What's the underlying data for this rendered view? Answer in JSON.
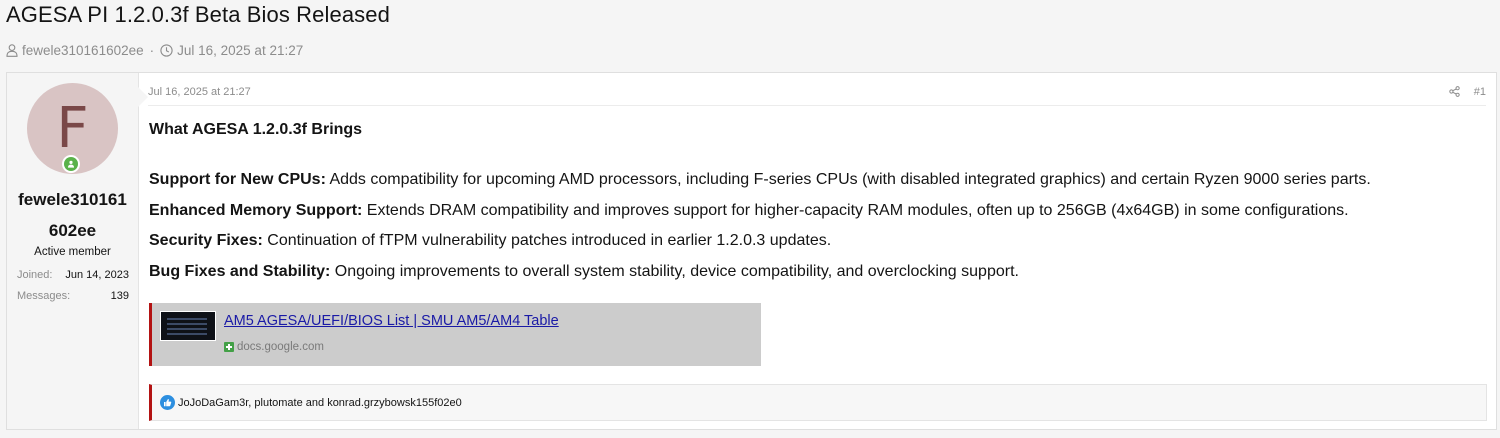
{
  "thread": {
    "title": "AGESA PI 1.2.0.3f Beta Bios Released",
    "author": "fewele310161602ee",
    "date": "Jul 16, 2025 at 21:27",
    "separator": "·"
  },
  "user": {
    "avatar_letter": "F",
    "name_line1": "fewele310161",
    "name_line2": "602ee",
    "title": "Active member",
    "joined_label": "Joined:",
    "joined_value": "Jun 14, 2023",
    "messages_label": "Messages:",
    "messages_value": "139"
  },
  "post": {
    "date": "Jul 16, 2025 at 21:27",
    "number": "#1",
    "heading": "What AGESA 1.2.0.3f Brings",
    "points": [
      {
        "label": "Support for New CPUs:",
        "text": " Adds compatibility for upcoming AMD processors, including F-series CPUs (with disabled integrated graphics) and certain Ryzen 9000 series parts."
      },
      {
        "label": "Enhanced Memory Support:",
        "text": " Extends DRAM compatibility and improves support for higher-capacity RAM modules, often up to 256GB (4x64GB) in some configurations."
      },
      {
        "label": "Security Fixes:",
        "text": " Continuation of fTPM vulnerability patches introduced in earlier 1.2.0.3 updates."
      },
      {
        "label": "Bug Fixes and Stability:",
        "text": " Ongoing improvements to overall system stability, device compatibility, and overclocking support."
      }
    ]
  },
  "embed": {
    "title": "AM5 AGESA/UEFI/BIOS List | SMU AM5/AM4 Table",
    "domain": "docs.google.com"
  },
  "reactions": {
    "text": "JoJoDaGam3r, plutomate and konrad.grzybowsk155f02e0"
  },
  "icons": {
    "author": "user-icon",
    "date": "clock-icon",
    "share": "share-icon",
    "online": "online-indicator-icon",
    "like": "like-icon",
    "embed_favicon": "google-docs-icon"
  },
  "colors": {
    "accent_bar": "#b31313",
    "online": "#5ab24a",
    "like": "#2d8fe0",
    "link": "#1a1aa6"
  }
}
